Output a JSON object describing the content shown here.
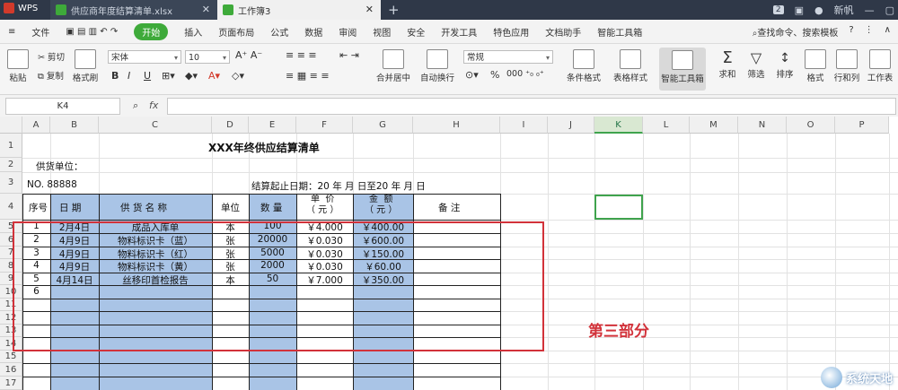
{
  "titlebar": {
    "app": "WPS",
    "file_tab": "供应商年度结算清单.xlsx",
    "active_tab": "工作簿3",
    "page_num": "2",
    "user": "新帆"
  },
  "menu": {
    "items": [
      "文件",
      "开始",
      "插入",
      "页面布局",
      "公式",
      "数据",
      "审阅",
      "视图",
      "安全",
      "开发工具",
      "特色应用",
      "文档助手",
      "智能工具箱"
    ],
    "search": "查找命令、搜索模板"
  },
  "ribbon": {
    "paste": "粘贴",
    "cut": "剪切",
    "copy": "复制",
    "format_painter": "格式刷",
    "font": "宋体",
    "size": "10",
    "merge": "合并居中",
    "wrap": "自动换行",
    "number_format": "常规",
    "percent": "%",
    "conditional": "条件格式",
    "table_style": "表格样式",
    "smart_toolbox": "智能工具箱",
    "sum": "求和",
    "filter": "筛选",
    "sort": "排序",
    "format": "格式",
    "rowcol": "行和列",
    "worksheet": "工作表",
    "bold": "B",
    "italic": "I",
    "underline": "U"
  },
  "formula": {
    "namebox": "K4",
    "fx": "fx"
  },
  "columns": [
    "A",
    "B",
    "C",
    "D",
    "E",
    "F",
    "G",
    "H",
    "I",
    "J",
    "K",
    "L",
    "M",
    "N",
    "O",
    "P"
  ],
  "rows": [
    "1",
    "2",
    "3",
    "4",
    "5",
    "6",
    "7",
    "8",
    "9",
    "10",
    "11",
    "12",
    "13",
    "14",
    "15",
    "16",
    "17"
  ],
  "sheet": {
    "title": "XXX年终供应结算清单",
    "supplier_label": "供货单位：",
    "no_label": "NO. 88888",
    "period": "结算起止日期：20  年  月  日至20  年  月  日",
    "headers": {
      "seq": "序号",
      "date": "日  期",
      "name": "供 货 名 称",
      "unit": "单位",
      "qty": "数  量",
      "price": "单  价\n（ 元 ）",
      "amount": "金  额\n（ 元 ）",
      "remark": "备    注"
    },
    "data": [
      {
        "seq": "1",
        "date": "2月4日",
        "name": "成品入库单",
        "unit": "本",
        "qty": "100",
        "price": "￥4.000",
        "amount": "￥400.00"
      },
      {
        "seq": "2",
        "date": "4月9日",
        "name": "物料标识卡（蓝）",
        "unit": "张",
        "qty": "20000",
        "price": "￥0.030",
        "amount": "￥600.00"
      },
      {
        "seq": "3",
        "date": "4月9日",
        "name": "物料标识卡（红）",
        "unit": "张",
        "qty": "5000",
        "price": "￥0.030",
        "amount": "￥150.00"
      },
      {
        "seq": "4",
        "date": "4月9日",
        "name": "物料标识卡（黄）",
        "unit": "张",
        "qty": "2000",
        "price": "￥0.030",
        "amount": "￥60.00"
      },
      {
        "seq": "5",
        "date": "4月14日",
        "name": "丝移印首检报告",
        "unit": "本",
        "qty": "50",
        "price": "￥7.000",
        "amount": "￥350.00"
      },
      {
        "seq": "6",
        "date": "",
        "name": "",
        "unit": "",
        "qty": "",
        "price": "",
        "amount": ""
      }
    ]
  },
  "annotation": "第三部分",
  "watermark": "系统天地"
}
